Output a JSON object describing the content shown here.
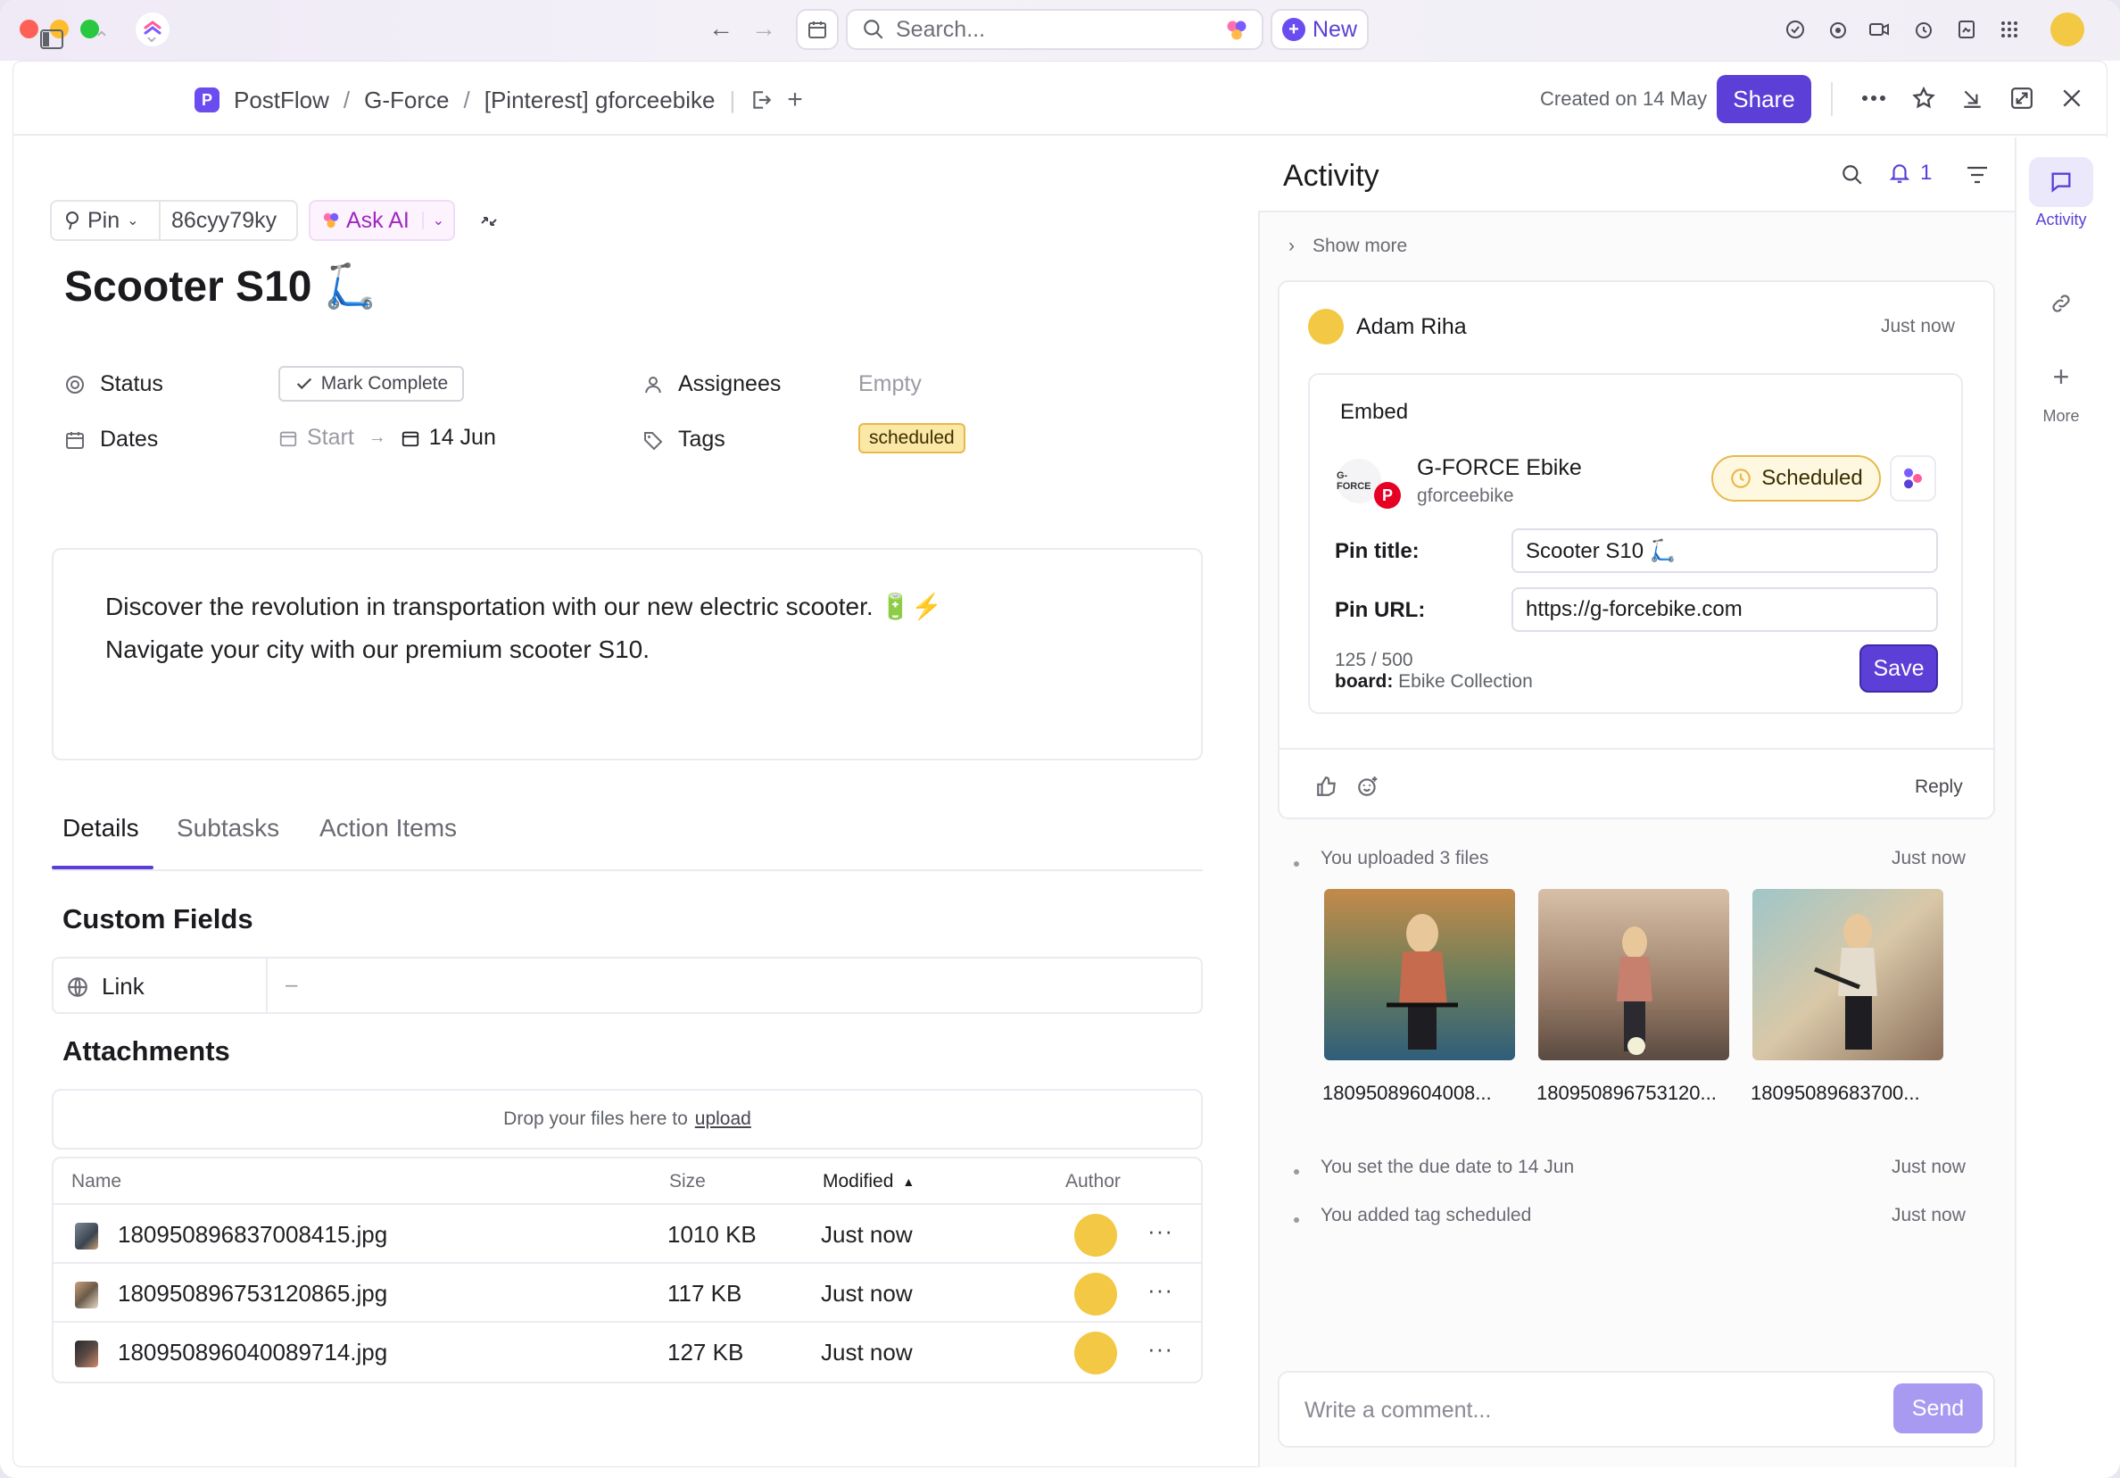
{
  "titlebar": {
    "search_placeholder": "Search...",
    "new_label": "New"
  },
  "toolbar": {
    "breadcrumbs": [
      "PostFlow",
      "G-Force",
      "[Pinterest] gforceebike"
    ],
    "space_badge": "P",
    "created": "Created on 14 May",
    "share_label": "Share"
  },
  "task": {
    "type_label": "Pin",
    "task_id": "86cyy79ky",
    "ask_ai_label": "Ask AI",
    "title": "Scooter S10 🛴",
    "status_label": "Status",
    "mark_complete_label": "Mark Complete",
    "assignees_label": "Assignees",
    "assignees_value": "Empty",
    "dates_label": "Dates",
    "start_label": "Start",
    "due_value": "14 Jun",
    "tags_label": "Tags",
    "tag_value": "scheduled",
    "description_line1": "Discover the revolution in transportation with our new electric scooter. 🔋⚡",
    "description_line2": "Navigate your city with our premium scooter S10."
  },
  "tabs": [
    "Details",
    "Subtasks",
    "Action Items"
  ],
  "custom_fields": {
    "heading": "Custom Fields",
    "link_label": "Link",
    "link_value": "–"
  },
  "attachments": {
    "heading": "Attachments",
    "drop_text": "Drop your files here to",
    "upload_link": "upload",
    "columns": [
      "Name",
      "Size",
      "Modified",
      "Author"
    ],
    "rows": [
      {
        "name": "180950896837008415.jpg",
        "size": "1010 KB",
        "modified": "Just now"
      },
      {
        "name": "180950896753120865.jpg",
        "size": "117 KB",
        "modified": "Just now"
      },
      {
        "name": "180950896040089714.jpg",
        "size": "127 KB",
        "modified": "Just now"
      }
    ]
  },
  "activity": {
    "title": "Activity",
    "notif_count": "1",
    "show_more": "Show more",
    "comment": {
      "author": "Adam Riha",
      "time": "Just now",
      "embed_label": "Embed",
      "account_name": "G-FORCE Ebike",
      "account_handle": "gforceebike",
      "logo_text": "G-FORCE",
      "status": "Scheduled",
      "pin_title_label": "Pin title:",
      "pin_title_value": "Scooter S10 🛴",
      "pin_url_label": "Pin URL:",
      "pin_url_value": "https://g-forcebike.com",
      "char_count": "125 / 500",
      "board_label": "board:",
      "board_value": "Ebike Collection",
      "save_label": "Save",
      "reply_label": "Reply"
    },
    "feed": [
      {
        "text": "You  uploaded 3 files",
        "time": "Just now"
      },
      {
        "text": "You set the due date to 14 Jun",
        "time": "Just now"
      },
      {
        "text": "You added tag scheduled",
        "time": "Just now"
      }
    ],
    "uploads": [
      "18095089604008...",
      "180950896753120...",
      "18095089683700..."
    ],
    "comment_placeholder": "Write a comment...",
    "send_label": "Send"
  },
  "rail": {
    "activity_label": "Activity",
    "more_label": "More"
  },
  "colors": {
    "accent": "#5b3fd6",
    "tag_bg": "#fbe7a6",
    "pinterest": "#e60023"
  }
}
